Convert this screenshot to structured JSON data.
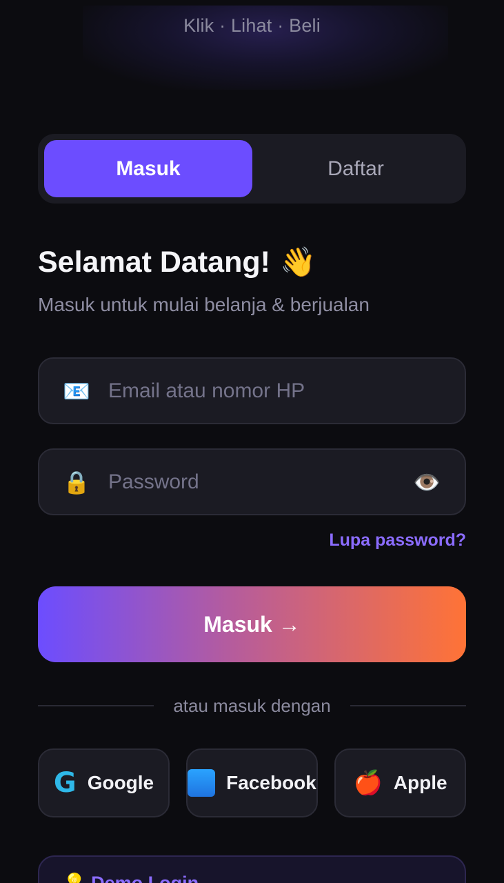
{
  "header": {
    "tagline": "Klik · Lihat · Beli"
  },
  "tabs": {
    "login_label": "Masuk",
    "register_label": "Daftar"
  },
  "welcome": {
    "title": "Selamat Datang!",
    "wave_emoji": "👋",
    "subtitle": "Masuk untuk mulai belanja & berjualan"
  },
  "form": {
    "email": {
      "icon": "📧",
      "placeholder": "Email atau nomor HP",
      "value": ""
    },
    "password": {
      "icon": "🔒",
      "placeholder": "Password",
      "value": "",
      "toggle_icon": "👁️"
    },
    "forgot_label": "Lupa password?",
    "submit_label": "Masuk →"
  },
  "divider": {
    "label": "atau masuk dengan"
  },
  "social": {
    "google": {
      "label": "Google",
      "icon": "G"
    },
    "facebook": {
      "label": "Facebook"
    },
    "apple": {
      "label": "Apple",
      "icon": "🍎"
    }
  },
  "bottom_card": {
    "icon": "💡",
    "text": "Demo Login"
  },
  "colors": {
    "accent": "#6c4dff",
    "link": "#8b6cff",
    "gradient_start": "#6c4dff",
    "gradient_end": "#ff7336",
    "background": "#0c0c10",
    "surface": "#1b1b23"
  }
}
